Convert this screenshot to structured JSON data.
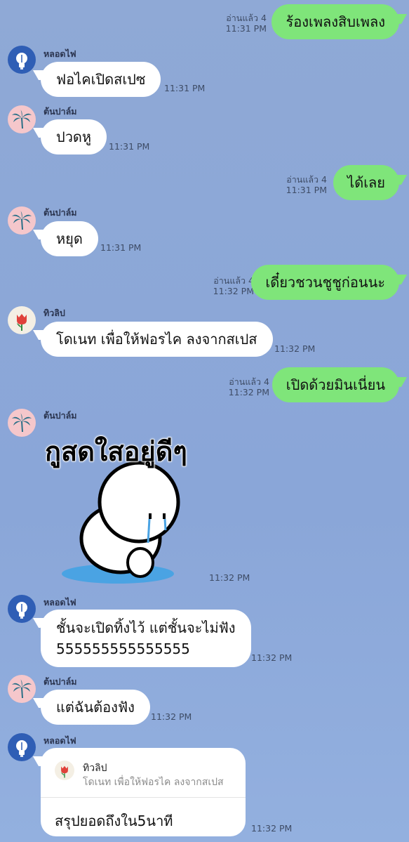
{
  "messages": {
    "m1": {
      "text": "ร้องเพลงสิบเพลง",
      "read": "อ่านแล้ว 4",
      "time": "11:31 PM"
    },
    "m2": {
      "sender": "หลอดไฟ",
      "text": "ฟอไคเปิดสเปซ",
      "time": "11:31 PM"
    },
    "m3": {
      "sender": "ต้นปาล์ม",
      "text": "ปวดหู",
      "time": "11:31 PM"
    },
    "m4": {
      "text": "ได้เลย",
      "read": "อ่านแล้ว 4",
      "time": "11:31 PM"
    },
    "m5": {
      "sender": "ต้นปาล์ม",
      "text": "หยุด",
      "time": "11:31 PM"
    },
    "m6": {
      "text": "เดี๋ยวชวนชูชูก่อนนะ",
      "read": "อ่านแล้ว 4",
      "time": "11:32 PM"
    },
    "m7": {
      "sender": "ทิวลิป",
      "text": "โดเนท เพื่อให้ฟอรไค ลงจากสเปส",
      "time": "11:32 PM"
    },
    "m8": {
      "text": "เปิดด้วยมินเนี่ยน",
      "read": "อ่านแล้ว 4",
      "time": "11:32 PM"
    },
    "m9": {
      "sender": "ต้นปาล์ม",
      "sticker_text": "กูสดใสอยู่ดีๆ",
      "time": "11:32 PM"
    },
    "m10": {
      "sender": "หลอดไฟ",
      "line1": "ชั้นจะเปิดทิ้งไว้ แต่ชั้นจะไม่ฟัง",
      "line2": "555555555555555",
      "time": "11:32 PM"
    },
    "m11": {
      "sender": "ต้นปาล์ม",
      "text": "แต่ฉันต้องฟัง",
      "time": "11:32 PM"
    },
    "m12": {
      "sender": "หลอดไฟ",
      "reply_name": "ทิวลิป",
      "reply_quote": "โดเนท เพื่อให้ฟอรไค ลงจากสเปส",
      "text": "สรุปยอดถึงใน5นาที",
      "time": "11:32 PM"
    }
  },
  "icons": {
    "bulb": "light-bulb-icon",
    "palm": "palm-tree-icon",
    "tulip": "tulip-icon"
  },
  "colors": {
    "background": "#8fa9d6",
    "outgoing_bubble": "#7fe57a",
    "incoming_bubble": "#ffffff"
  }
}
